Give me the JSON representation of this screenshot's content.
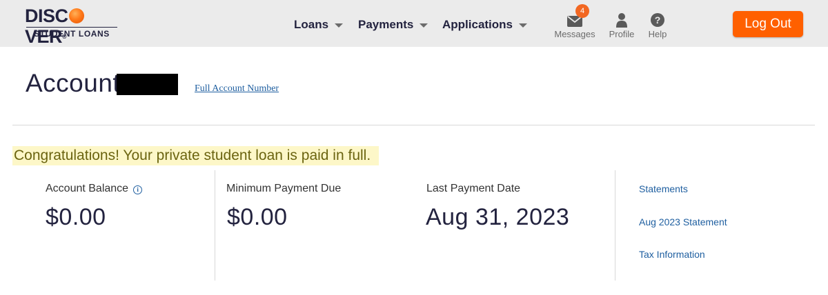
{
  "logo": {
    "word_start": "DISC",
    "word_end": "VER",
    "registered": "®",
    "subtitle": "STUDENT LOANS"
  },
  "nav": {
    "items": [
      {
        "label": "Loans"
      },
      {
        "label": "Payments"
      },
      {
        "label": "Applications"
      }
    ]
  },
  "utility": {
    "messages": {
      "label": "Messages",
      "badge": "4",
      "icon": "envelope-icon"
    },
    "profile": {
      "label": "Profile",
      "icon": "user-icon"
    },
    "help": {
      "label": "Help",
      "icon": "question-icon"
    }
  },
  "logout_label": "Log Out",
  "account": {
    "title": "Account",
    "full_number_link": "Full Account Number"
  },
  "congrats_message": "Congratulations! Your private student loan is paid in full.",
  "summary": {
    "account_balance": {
      "label": "Account Balance",
      "value": "$0.00"
    },
    "minimum_payment": {
      "label": "Minimum Payment Due",
      "value": "$0.00"
    },
    "last_payment": {
      "label": "Last Payment Date",
      "value": "Aug 31, 2023"
    }
  },
  "side_links": [
    "Statements",
    "Aug 2023 Statement",
    "Tax Information"
  ],
  "colors": {
    "brand_orange": "#ff6000",
    "link_blue": "#1f5fa0",
    "highlight_yellow": "#fdf7c8",
    "header_gray": "#ebebeb"
  }
}
